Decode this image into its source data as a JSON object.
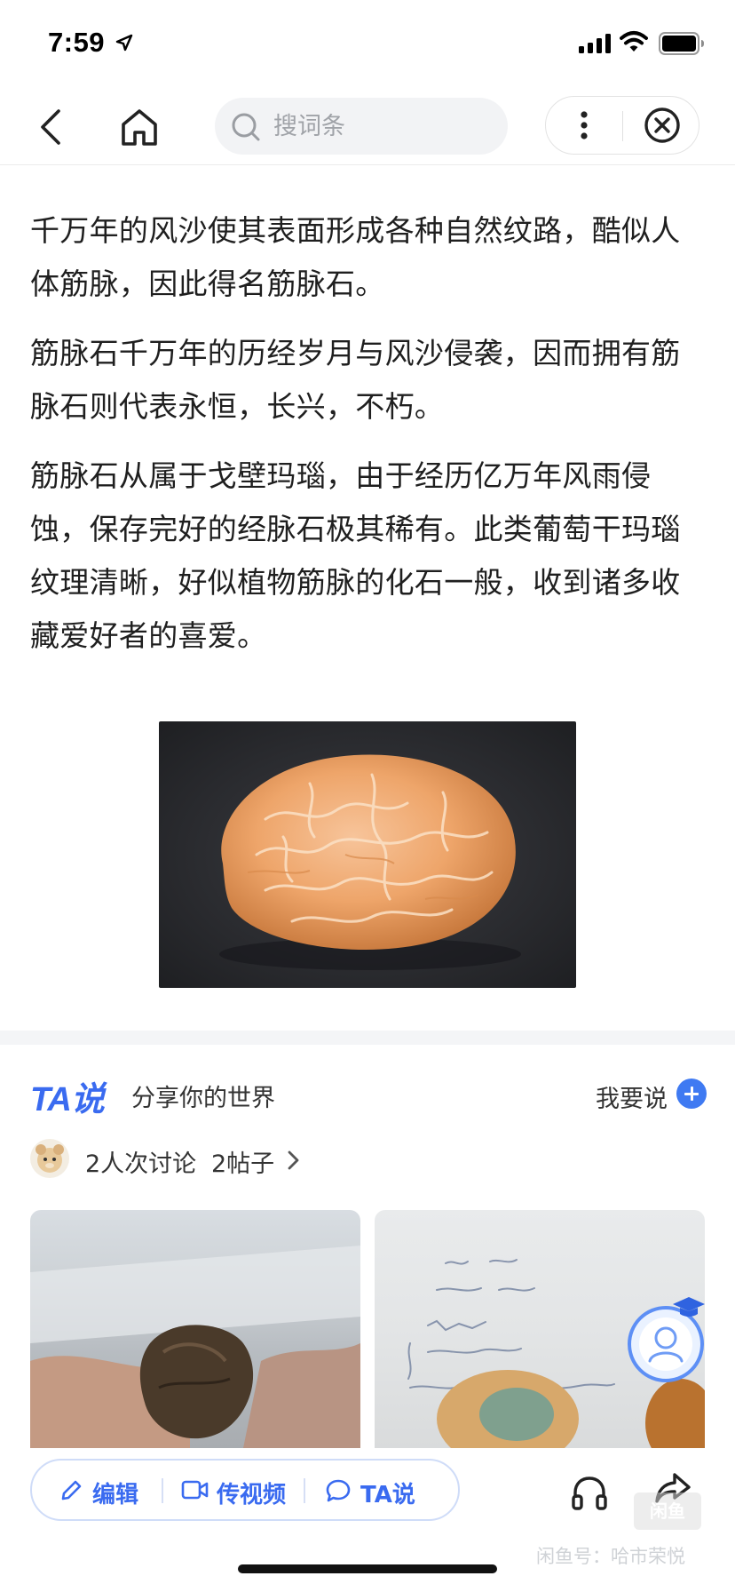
{
  "status_bar": {
    "time": "7:59"
  },
  "nav": {
    "search_placeholder": "搜词条"
  },
  "article": {
    "paragraphs": [
      "千万年的风沙使其表面形成各种自然纹路，酷似人体筋脉，因此得名筋脉石。",
      "筋脉石千万年的历经岁月与风沙侵袭，因而拥有筋脉石则代表永恒，长兴，不朽。",
      "筋脉石从属于戈壁玛瑙，由于经历亿万年风雨侵蚀，保存完好的经脉石极其稀有。此类葡萄干玛瑙纹理清晰，好似植物筋脉的化石一般，收到诸多收藏爱好者的喜爱。"
    ]
  },
  "ta_section": {
    "logo": "TA说",
    "slogan": "分享你的世界",
    "post_label": "我要说",
    "discussion_count": "2人次讨论",
    "posts_count": "2帖子"
  },
  "bottom_bar": {
    "edit_label": "编辑",
    "video_label": "传视频",
    "ta_label": "TA说"
  },
  "watermark": {
    "badge": "闲鱼",
    "text": "闲鱼号：哈市荣悦"
  },
  "colors": {
    "accent": "#3a6bf0",
    "text": "#1f1f1f"
  },
  "icons": [
    "location-arrow-icon",
    "signal-icon",
    "wifi-icon",
    "battery-icon",
    "back-icon",
    "home-icon",
    "search-icon",
    "more-icon",
    "close-icon",
    "plus-icon",
    "chevron-right-icon",
    "pencil-icon",
    "video-icon",
    "chat-bubble-icon",
    "headphones-icon",
    "share-icon",
    "graduation-cap-icon"
  ]
}
